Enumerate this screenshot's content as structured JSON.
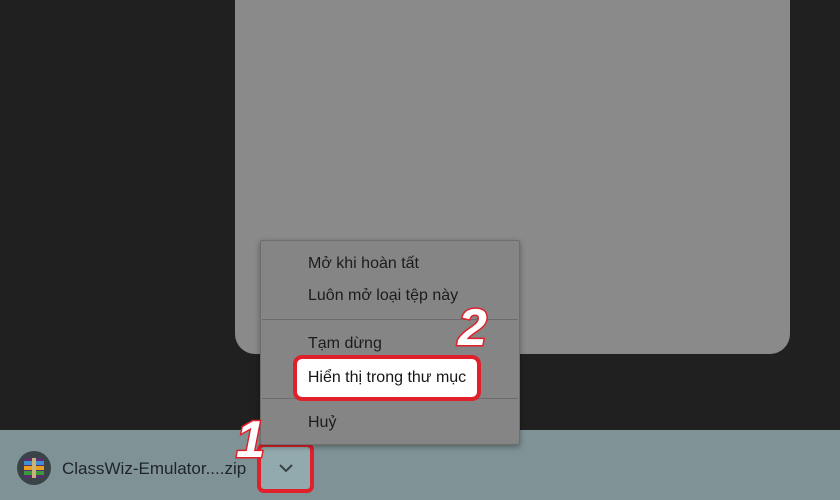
{
  "download_bar": {
    "file_name": "ClassWiz-Emulator....zip",
    "file_icon": "winrar-archive-icon",
    "chevron_icon": "chevron-down-icon"
  },
  "context_menu": {
    "items": [
      {
        "label": "Mở khi hoàn tất"
      },
      {
        "label": "Luôn mở loại tệp này"
      },
      {
        "label": "Tạm dừng"
      },
      {
        "label": "Hiển thị trong thư mục",
        "highlighted": true
      },
      {
        "label": "Huỷ"
      }
    ]
  },
  "annotations": {
    "step1": "1",
    "step2": "2",
    "highlight_color": "#e0202a"
  }
}
